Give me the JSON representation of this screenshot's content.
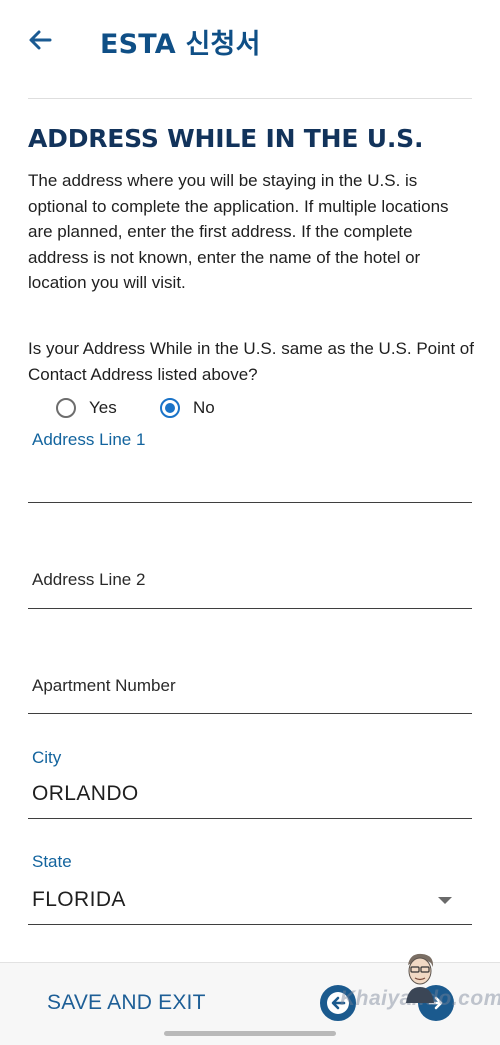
{
  "header": {
    "title": "ESTA 신청서",
    "back_icon": "arrow-left-icon"
  },
  "section": {
    "title": "ADDRESS WHILE IN THE U.S.",
    "description": "The address where you will be staying in the U.S. is optional to complete the application. If multiple locations are planned, enter the first address. If the complete address is not known, enter the name of the hotel or location you will visit."
  },
  "question": {
    "text": "Is your Address While in the U.S. same as the U.S. Point of Contact Address listed above?",
    "options": [
      {
        "label": "Yes",
        "selected": false
      },
      {
        "label": "No",
        "selected": true
      }
    ]
  },
  "form": {
    "address_line_1": {
      "label": "Address Line 1",
      "value": ""
    },
    "address_line_2": {
      "label": "Address Line 2",
      "value": ""
    },
    "apartment_number": {
      "label": "Apartment Number",
      "value": ""
    },
    "city": {
      "label": "City",
      "value": "ORLANDO"
    },
    "state": {
      "label": "State",
      "value": "FLORIDA"
    }
  },
  "footer": {
    "save_exit_label": "SAVE AND EXIT",
    "prev_icon": "arrow-left-circle-icon",
    "next_icon": "arrow-right-circle-icon",
    "watermark_text": "Khaiyando.com"
  },
  "colors": {
    "accent": "#1a73c8",
    "title": "#0f4f86",
    "heading": "#12335b",
    "label_active": "#13649e"
  }
}
